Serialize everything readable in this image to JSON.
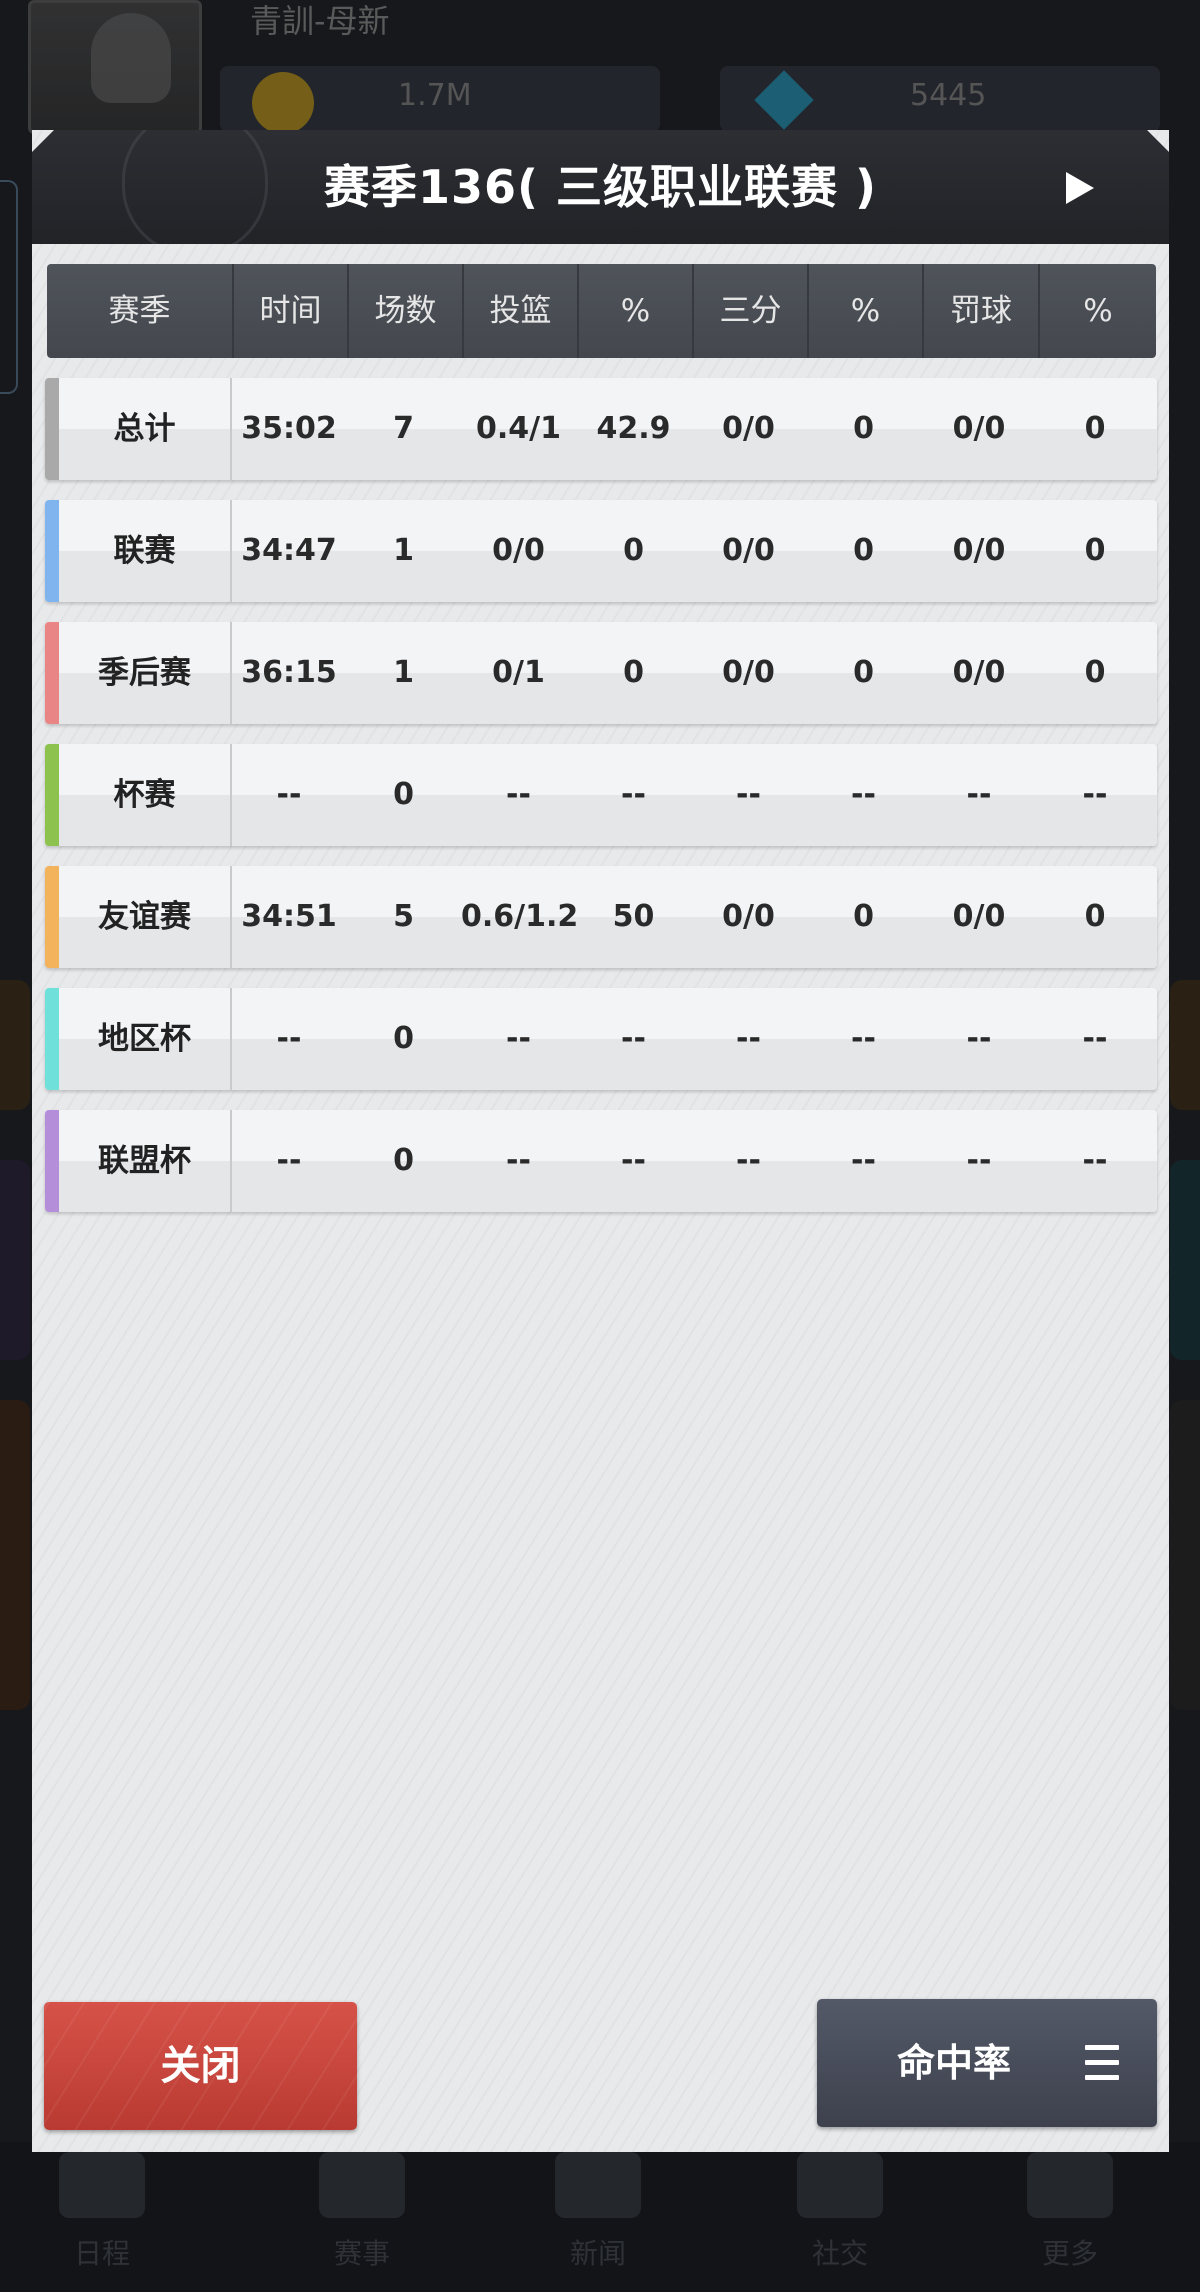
{
  "background": {
    "name_text": "青訓-母新",
    "coins": "1.7M",
    "gems": "5445",
    "nav_items": [
      "日程",
      "赛事",
      "新闻",
      "社交",
      "更多"
    ]
  },
  "dialog": {
    "title": "赛季136( 三级职业联赛 )",
    "columns": [
      "赛季",
      "时间",
      "场数",
      "投篮",
      "%",
      "三分",
      "%",
      "罚球",
      "%"
    ],
    "rows": [
      {
        "label": "总计",
        "accent": "#a9a9a9",
        "values": [
          "35:02",
          "7",
          "0.4/1",
          "42.9",
          "0/0",
          "0",
          "0/0",
          "0"
        ]
      },
      {
        "label": "联赛",
        "accent": "#7fb4ef",
        "values": [
          "34:47",
          "1",
          "0/0",
          "0",
          "0/0",
          "0",
          "0/0",
          "0"
        ]
      },
      {
        "label": "季后赛",
        "accent": "#ea8585",
        "values": [
          "36:15",
          "1",
          "0/1",
          "0",
          "0/0",
          "0",
          "0/0",
          "0"
        ]
      },
      {
        "label": "杯赛",
        "accent": "#8cc24d",
        "values": [
          "--",
          "0",
          "--",
          "--",
          "--",
          "--",
          "--",
          "--"
        ]
      },
      {
        "label": "友谊赛",
        "accent": "#f3b25c",
        "values": [
          "34:51",
          "5",
          "0.6/1.2",
          "50",
          "0/0",
          "0",
          "0/0",
          "0"
        ]
      },
      {
        "label": "地区杯",
        "accent": "#6fe1da",
        "values": [
          "--",
          "0",
          "--",
          "--",
          "--",
          "--",
          "--",
          "--"
        ]
      },
      {
        "label": "联盟杯",
        "accent": "#b48ed9",
        "values": [
          "--",
          "0",
          "--",
          "--",
          "--",
          "--",
          "--",
          "--"
        ]
      }
    ],
    "close_label": "关闭",
    "rate_label": "命中率"
  },
  "colors": {
    "header_bg": "#26282c",
    "close_button": "#c8443b",
    "rate_button": "#4a4e5a"
  },
  "icons": {
    "play": "play-icon",
    "menu": "menu-icon"
  }
}
